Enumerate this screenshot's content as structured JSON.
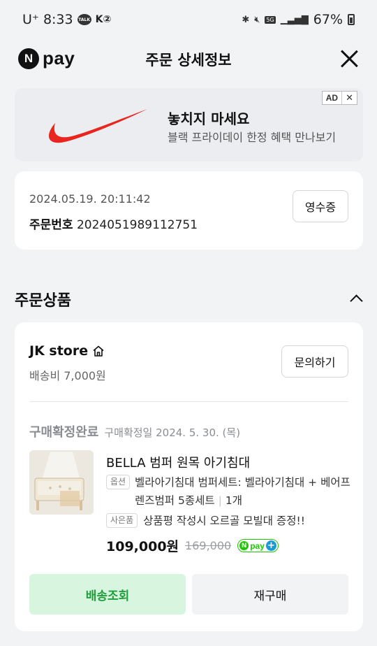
{
  "status_bar": {
    "carrier": "U⁺",
    "time": "8:33",
    "talk": "TALK",
    "k2": "K②",
    "network": "5G",
    "battery": "67%"
  },
  "header": {
    "logo_n": "N",
    "logo_pay": "pay",
    "title": "주문 상세정보"
  },
  "ad": {
    "title": "놓치지 마세요",
    "subtitle": "블랙 프라이데이 한정 혜택 만나보기",
    "badge": "AD",
    "close": "✕",
    "brand_color": "#e8251e"
  },
  "order": {
    "datetime": "2024.05.19. 20:11:42",
    "number_label": "주문번호",
    "number": "2024051989112751",
    "receipt_label": "영수증"
  },
  "section": {
    "title": "주문상품"
  },
  "product_card": {
    "store_name": "JK store",
    "shipping_fee": "배송비 7,000원",
    "inquiry_label": "문의하기",
    "status": "구매확정완료",
    "status_date": "구매확정일 2024. 5. 30. (목)",
    "product_name": "BELLA 범퍼 원목 아기침대",
    "option_tag": "옵션",
    "option_text": "벨라아기침대 범퍼세트: 벨라아기침대 + 베어프렌즈범퍼 5종세트",
    "quantity": "1개",
    "gift_tag": "사은품",
    "gift_text": "상품평 작성시 오르골 모빌대 증정!!",
    "price": "109,000원",
    "original_price": "169,000",
    "npay_n": "N",
    "npay_pay": "pay",
    "npay_plus": "+",
    "track_label": "배송조회",
    "rebuy_label": "재구매"
  }
}
